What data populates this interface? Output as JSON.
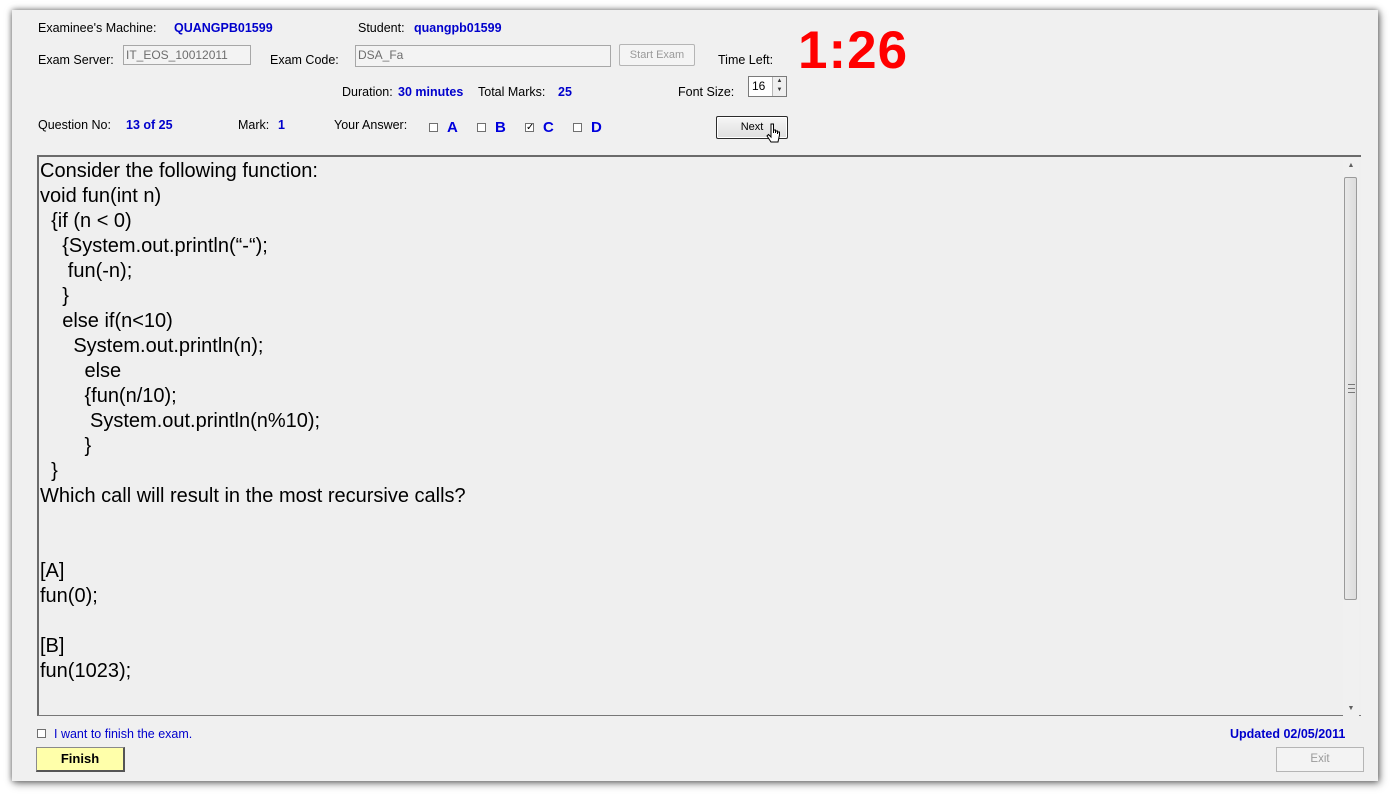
{
  "header": {
    "machine_label": "Examinee's Machine:",
    "machine_value": "QUANGPB01599",
    "student_label": "Student:",
    "student_value": "quangpb01599",
    "server_label": "Exam Server:",
    "server_value": "IT_EOS_10012011",
    "code_label": "Exam Code:",
    "code_value": "DSA_Fa",
    "start_button": "Start Exam",
    "time_label": "Time Left:",
    "timer": "1:26",
    "duration_label": "Duration:",
    "duration_value": "30 minutes",
    "total_label": "Total Marks:",
    "total_value": "25",
    "font_label": "Font Size:",
    "font_value": "16",
    "question_label": "Question No:",
    "question_value": "13 of 25",
    "mark_label": "Mark:",
    "mark_value": "1",
    "answer_label": "Your Answer:",
    "next_button": "Next"
  },
  "answers": [
    {
      "label": "A",
      "checked": false
    },
    {
      "label": "B",
      "checked": false
    },
    {
      "label": "C",
      "checked": true
    },
    {
      "label": "D",
      "checked": false
    }
  ],
  "question": {
    "text": "Consider the following function:\nvoid fun(int n)\n  {if (n < 0)\n    {System.out.println(“-“);\n     fun(-n);\n    }\n    else if(n<10)\n      System.out.println(n);\n        else\n        {fun(n/10);\n         System.out.println(n%10);\n        }\n  }\nWhich call will result in the most recursive calls?\n\n\n[A]\nfun(0);\n\n[B]\nfun(1023);"
  },
  "footer": {
    "finish_check_label": "I want to finish the exam.",
    "finish_checked": false,
    "updated": "Updated 02/05/2011",
    "finish_button": "Finish",
    "exit_button": "Exit"
  },
  "colors": {
    "value_blue": "#0000cc",
    "timer_red": "#ff0000",
    "finish_yellow": "#ffffaa",
    "window_bg": "#f0f0f0"
  }
}
